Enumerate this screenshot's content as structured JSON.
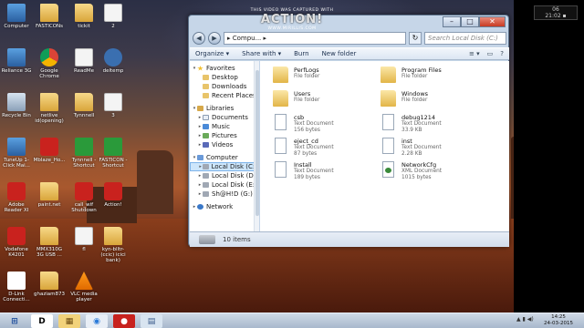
{
  "desktop_icons": [
    {
      "label": "Computer",
      "icon": "computer-icon"
    },
    {
      "label": "Reliance 3G",
      "icon": "modem-icon"
    },
    {
      "label": "Recycle Bin",
      "icon": "recycle-bin-icon"
    },
    {
      "label": "TuneUp 1-Click Mai...",
      "icon": "tuneup-icon"
    },
    {
      "label": "Adobe Reader XI",
      "icon": "adobe-reader-icon"
    },
    {
      "label": "Vodafone K4201",
      "icon": "vodafone-icon"
    },
    {
      "label": "D-Link Connecti...",
      "icon": "dlink-icon"
    },
    {
      "label": "FASTICONs",
      "icon": "folder-icon"
    },
    {
      "label": "Google Chrome",
      "icon": "chrome-icon"
    },
    {
      "label": "netlive id(opening)",
      "icon": "folder-icon"
    },
    {
      "label": "Mblaze_Ho...",
      "icon": "mblaze-icon"
    },
    {
      "label": "paint.net",
      "icon": "folder-icon"
    },
    {
      "label": "MMX310G 3G USB ...",
      "icon": "mmx-icon"
    },
    {
      "label": "ghaziam873",
      "icon": "folder-icon"
    },
    {
      "label": "tickit",
      "icon": "folder-icon"
    },
    {
      "label": "ReadMe",
      "icon": "file-icon"
    },
    {
      "label": "Tynnnell",
      "icon": "folder-icon"
    },
    {
      "label": "Tynnnell - Shortcut",
      "icon": "shortcut-icon"
    },
    {
      "label": "call_wif Shutdown",
      "icon": "app-icon"
    },
    {
      "label": "fl",
      "icon": "file-icon"
    },
    {
      "label": "VLC media player",
      "icon": "vlc-icon"
    },
    {
      "label": "2",
      "icon": "file-icon"
    },
    {
      "label": "deltemp",
      "icon": "gear-icon"
    },
    {
      "label": "3",
      "icon": "file-icon"
    },
    {
      "label": "FASTICON - Shortcut",
      "icon": "shortcut-icon"
    },
    {
      "label": "Action!",
      "icon": "action-icon"
    },
    {
      "label": "kyn-blltr-(ccic) icici bank)",
      "icon": "folder-icon"
    }
  ],
  "clock_widget": {
    "line1": "06",
    "line2": "21:02 ▪"
  },
  "watermark": {
    "top": "THIS VIDEO WAS CAPTURED WITH",
    "logo": "ACTION!",
    "url": "WWW.MIRILLIS.COM"
  },
  "explorer": {
    "buttons": {
      "minimize": "–",
      "maximize": "□",
      "close": "✕"
    },
    "nav": {
      "back": "◀",
      "forward": "▶",
      "address": "▸ Compu... ▸",
      "refresh": "↻",
      "search_placeholder": "Search Local Disk (C:)"
    },
    "toolbar": {
      "organize": "Organize ▾",
      "share": "Share with ▾",
      "burn": "Burn",
      "new_folder": "New folder",
      "views": "≡ ▾",
      "preview": "▭",
      "help": "?"
    },
    "nav_pane": [
      {
        "label": "Favorites",
        "icon": "star",
        "indent": 0,
        "arrow": "▾"
      },
      {
        "label": "Desktop",
        "icon": "fold",
        "indent": 1
      },
      {
        "label": "Downloads",
        "icon": "fold",
        "indent": 1
      },
      {
        "label": "Recent Places",
        "icon": "fold",
        "indent": 1
      },
      {
        "label": "",
        "icon": "",
        "indent": 0,
        "spacer": true
      },
      {
        "label": "Libraries",
        "icon": "lib",
        "indent": 0,
        "arrow": "▾"
      },
      {
        "label": "Documents",
        "icon": "doc",
        "indent": 1,
        "arrow": "▸"
      },
      {
        "label": "Music",
        "icon": "music",
        "indent": 1,
        "arrow": "▸"
      },
      {
        "label": "Pictures",
        "icon": "pic",
        "indent": 1,
        "arrow": "▸"
      },
      {
        "label": "Videos",
        "icon": "vid",
        "indent": 1,
        "arrow": "▸"
      },
      {
        "label": "",
        "icon": "",
        "indent": 0,
        "spacer": true
      },
      {
        "label": "Computer",
        "icon": "comp",
        "indent": 0,
        "arrow": "▾"
      },
      {
        "label": "Local Disk (C:)",
        "icon": "disk",
        "indent": 1,
        "arrow": "▸",
        "selected": true
      },
      {
        "label": "Local Disk (D:)",
        "icon": "disk",
        "indent": 1,
        "arrow": "▸"
      },
      {
        "label": "Local Disk (E:)",
        "icon": "disk",
        "indent": 1,
        "arrow": "▸"
      },
      {
        "label": "Sh@H!D (G:)",
        "icon": "disk",
        "indent": 1,
        "arrow": "▸"
      },
      {
        "label": "",
        "icon": "",
        "indent": 0,
        "spacer": true
      },
      {
        "label": "Network",
        "icon": "net",
        "indent": 0,
        "arrow": "▸"
      }
    ],
    "files": [
      {
        "name": "PerfLogs",
        "meta1": "File folder",
        "meta2": "",
        "type": "folder"
      },
      {
        "name": "Program Files",
        "meta1": "File folder",
        "meta2": "",
        "type": "folder"
      },
      {
        "name": "Users",
        "meta1": "File folder",
        "meta2": "",
        "type": "folder"
      },
      {
        "name": "Windows",
        "meta1": "File folder",
        "meta2": "",
        "type": "folder"
      },
      {
        "name": "csb",
        "meta1": "Text Document",
        "meta2": "156 bytes",
        "type": "text"
      },
      {
        "name": "debug1214",
        "meta1": "Text Document",
        "meta2": "33.9 KB",
        "type": "text"
      },
      {
        "name": "eject_cd",
        "meta1": "Text Document",
        "meta2": "87 bytes",
        "type": "text"
      },
      {
        "name": "inst",
        "meta1": "Text Document",
        "meta2": "2.28 KB",
        "type": "text"
      },
      {
        "name": "Install",
        "meta1": "Text Document",
        "meta2": "189 bytes",
        "type": "text"
      },
      {
        "name": "NetworkCfg",
        "meta1": "XML Document",
        "meta2": "1015 bytes",
        "type": "xml"
      }
    ],
    "status": "10 items"
  },
  "taskbar": {
    "start": "⊞",
    "items": [
      {
        "label": "D",
        "name": "taskbar-dlink",
        "bg": "#ffffff",
        "fg": "#000000"
      },
      {
        "label": "▦",
        "name": "taskbar-explorer",
        "bg": "#f2d27a",
        "fg": "#6a4a10"
      },
      {
        "label": "◉",
        "name": "taskbar-chrome",
        "bg": "#e8eef6",
        "fg": "#2a7ad8"
      },
      {
        "label": "●",
        "name": "taskbar-action",
        "bg": "#c8221e",
        "fg": "#ffffff"
      },
      {
        "label": "▤",
        "name": "taskbar-app",
        "bg": "#d8e4f0",
        "fg": "#3a5a8a"
      }
    ],
    "tray": "▲ ▮ ◀)",
    "time": "14:25",
    "date": "24-03-2015"
  }
}
